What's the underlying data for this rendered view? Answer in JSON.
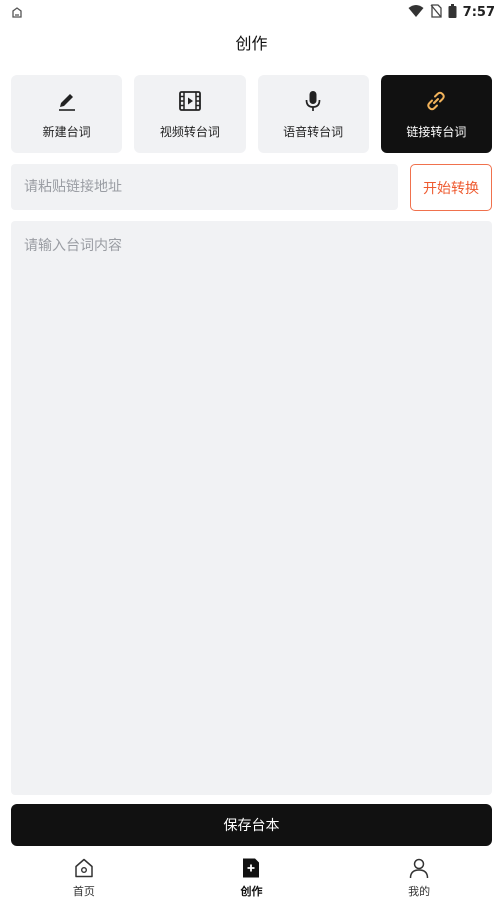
{
  "status_bar": {
    "time": "7:57"
  },
  "header": {
    "title": "创作"
  },
  "modes": [
    {
      "label": "新建台词",
      "icon": "pencil-icon",
      "active": false
    },
    {
      "label": "视频转台词",
      "icon": "film-icon",
      "active": false
    },
    {
      "label": "语音转台词",
      "icon": "microphone-icon",
      "active": false
    },
    {
      "label": "链接转台词",
      "icon": "link-icon",
      "active": true
    }
  ],
  "link_input": {
    "placeholder": "请粘贴链接地址",
    "value": ""
  },
  "convert_button": {
    "label": "开始转换"
  },
  "content_input": {
    "placeholder": "请输入台词内容",
    "value": ""
  },
  "save_button": {
    "label": "保存台本"
  },
  "bottom_nav": [
    {
      "label": "首页",
      "icon": "home-icon",
      "active": false
    },
    {
      "label": "创作",
      "icon": "create-doc-icon",
      "active": true
    },
    {
      "label": "我的",
      "icon": "user-icon",
      "active": false
    }
  ],
  "colors": {
    "accent": "#ee5a2f",
    "active_card": "#111111",
    "card_bg": "#f1f2f4",
    "link_icon": "#f2b35b"
  }
}
